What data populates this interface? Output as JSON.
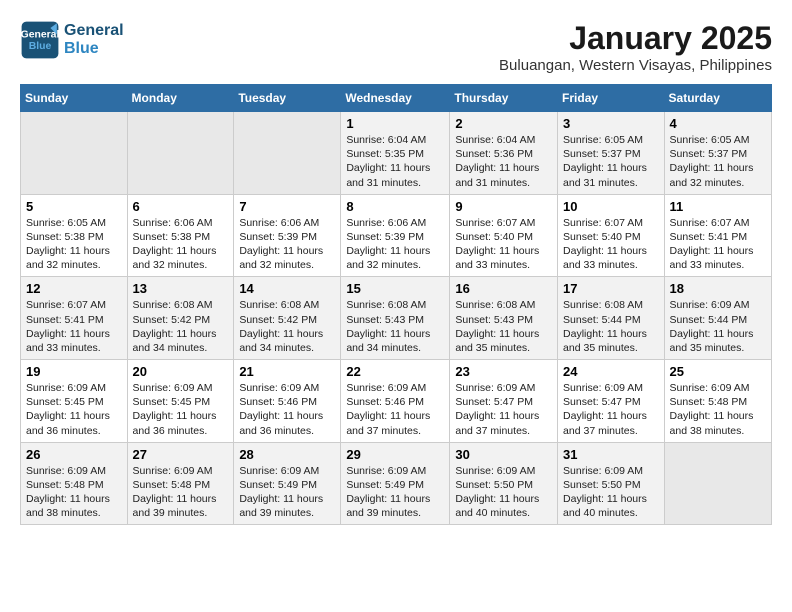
{
  "header": {
    "logo_line1": "General",
    "logo_line2": "Blue",
    "title": "January 2025",
    "subtitle": "Buluangan, Western Visayas, Philippines"
  },
  "days_of_week": [
    "Sunday",
    "Monday",
    "Tuesday",
    "Wednesday",
    "Thursday",
    "Friday",
    "Saturday"
  ],
  "weeks": [
    {
      "days": [
        {
          "num": "",
          "empty": true
        },
        {
          "num": "",
          "empty": true
        },
        {
          "num": "",
          "empty": true
        },
        {
          "num": "1",
          "sunrise": "6:04 AM",
          "sunset": "5:35 PM",
          "daylight": "11 hours and 31 minutes."
        },
        {
          "num": "2",
          "sunrise": "6:04 AM",
          "sunset": "5:36 PM",
          "daylight": "11 hours and 31 minutes."
        },
        {
          "num": "3",
          "sunrise": "6:05 AM",
          "sunset": "5:37 PM",
          "daylight": "11 hours and 31 minutes."
        },
        {
          "num": "4",
          "sunrise": "6:05 AM",
          "sunset": "5:37 PM",
          "daylight": "11 hours and 32 minutes."
        }
      ]
    },
    {
      "days": [
        {
          "num": "5",
          "sunrise": "6:05 AM",
          "sunset": "5:38 PM",
          "daylight": "11 hours and 32 minutes."
        },
        {
          "num": "6",
          "sunrise": "6:06 AM",
          "sunset": "5:38 PM",
          "daylight": "11 hours and 32 minutes."
        },
        {
          "num": "7",
          "sunrise": "6:06 AM",
          "sunset": "5:39 PM",
          "daylight": "11 hours and 32 minutes."
        },
        {
          "num": "8",
          "sunrise": "6:06 AM",
          "sunset": "5:39 PM",
          "daylight": "11 hours and 32 minutes."
        },
        {
          "num": "9",
          "sunrise": "6:07 AM",
          "sunset": "5:40 PM",
          "daylight": "11 hours and 33 minutes."
        },
        {
          "num": "10",
          "sunrise": "6:07 AM",
          "sunset": "5:40 PM",
          "daylight": "11 hours and 33 minutes."
        },
        {
          "num": "11",
          "sunrise": "6:07 AM",
          "sunset": "5:41 PM",
          "daylight": "11 hours and 33 minutes."
        }
      ]
    },
    {
      "days": [
        {
          "num": "12",
          "sunrise": "6:07 AM",
          "sunset": "5:41 PM",
          "daylight": "11 hours and 33 minutes."
        },
        {
          "num": "13",
          "sunrise": "6:08 AM",
          "sunset": "5:42 PM",
          "daylight": "11 hours and 34 minutes."
        },
        {
          "num": "14",
          "sunrise": "6:08 AM",
          "sunset": "5:42 PM",
          "daylight": "11 hours and 34 minutes."
        },
        {
          "num": "15",
          "sunrise": "6:08 AM",
          "sunset": "5:43 PM",
          "daylight": "11 hours and 34 minutes."
        },
        {
          "num": "16",
          "sunrise": "6:08 AM",
          "sunset": "5:43 PM",
          "daylight": "11 hours and 35 minutes."
        },
        {
          "num": "17",
          "sunrise": "6:08 AM",
          "sunset": "5:44 PM",
          "daylight": "11 hours and 35 minutes."
        },
        {
          "num": "18",
          "sunrise": "6:09 AM",
          "sunset": "5:44 PM",
          "daylight": "11 hours and 35 minutes."
        }
      ]
    },
    {
      "days": [
        {
          "num": "19",
          "sunrise": "6:09 AM",
          "sunset": "5:45 PM",
          "daylight": "11 hours and 36 minutes."
        },
        {
          "num": "20",
          "sunrise": "6:09 AM",
          "sunset": "5:45 PM",
          "daylight": "11 hours and 36 minutes."
        },
        {
          "num": "21",
          "sunrise": "6:09 AM",
          "sunset": "5:46 PM",
          "daylight": "11 hours and 36 minutes."
        },
        {
          "num": "22",
          "sunrise": "6:09 AM",
          "sunset": "5:46 PM",
          "daylight": "11 hours and 37 minutes."
        },
        {
          "num": "23",
          "sunrise": "6:09 AM",
          "sunset": "5:47 PM",
          "daylight": "11 hours and 37 minutes."
        },
        {
          "num": "24",
          "sunrise": "6:09 AM",
          "sunset": "5:47 PM",
          "daylight": "11 hours and 37 minutes."
        },
        {
          "num": "25",
          "sunrise": "6:09 AM",
          "sunset": "5:48 PM",
          "daylight": "11 hours and 38 minutes."
        }
      ]
    },
    {
      "days": [
        {
          "num": "26",
          "sunrise": "6:09 AM",
          "sunset": "5:48 PM",
          "daylight": "11 hours and 38 minutes."
        },
        {
          "num": "27",
          "sunrise": "6:09 AM",
          "sunset": "5:48 PM",
          "daylight": "11 hours and 39 minutes."
        },
        {
          "num": "28",
          "sunrise": "6:09 AM",
          "sunset": "5:49 PM",
          "daylight": "11 hours and 39 minutes."
        },
        {
          "num": "29",
          "sunrise": "6:09 AM",
          "sunset": "5:49 PM",
          "daylight": "11 hours and 39 minutes."
        },
        {
          "num": "30",
          "sunrise": "6:09 AM",
          "sunset": "5:50 PM",
          "daylight": "11 hours and 40 minutes."
        },
        {
          "num": "31",
          "sunrise": "6:09 AM",
          "sunset": "5:50 PM",
          "daylight": "11 hours and 40 minutes."
        },
        {
          "num": "",
          "empty": true
        }
      ]
    }
  ],
  "labels": {
    "sunrise": "Sunrise:",
    "sunset": "Sunset:",
    "daylight": "Daylight:"
  }
}
